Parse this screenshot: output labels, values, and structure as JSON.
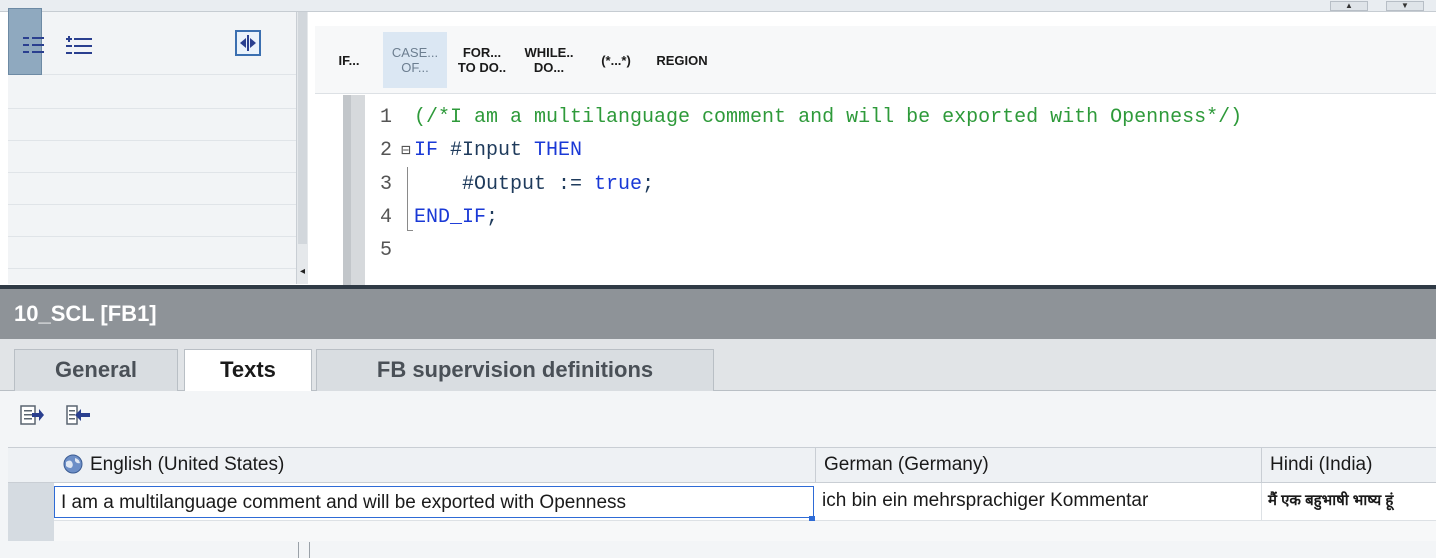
{
  "editor": {
    "toolbar": [
      {
        "label": "IF..."
      },
      {
        "label": "CASE...\nOF..."
      },
      {
        "label": "FOR...\nTO DO.."
      },
      {
        "label": "WHILE..\nDO..."
      },
      {
        "label": "(*...*)"
      },
      {
        "label": "REGION"
      }
    ],
    "code": {
      "line_numbers": [
        "1",
        "2",
        "3",
        "4",
        "5"
      ],
      "line1_comment": "(/*I am a multilanguage comment and will be exported with Openness*/)",
      "line2_if": "IF",
      "line2_var": " #Input ",
      "line2_then": "THEN",
      "line3_indent": "    ",
      "line3_var": "#Output := ",
      "line3_value": "true",
      "line3_end": ";",
      "line4_end_if": "END_IF",
      "line4_semicolon": ";"
    }
  },
  "inspector": {
    "title": "10_SCL [FB1]",
    "tabs": [
      {
        "label": "General",
        "active": false
      },
      {
        "label": "Texts",
        "active": true
      },
      {
        "label": "FB supervision definitions",
        "active": false
      }
    ]
  },
  "texts_table": {
    "columns": [
      {
        "label": "English (United States)"
      },
      {
        "label": "German (Germany)"
      },
      {
        "label": "Hindi (India)"
      }
    ],
    "row": {
      "english": "I am a multilanguage comment and will be exported with Openness",
      "german": "ich bin ein mehrsprachiger Kommentar",
      "hindi": "मैं एक बहुभाषी भाष्य हूं"
    }
  },
  "icons": {
    "left_toolbar": [
      "collapse-all-icon",
      "expand-list-icon",
      "swap-panes-icon"
    ],
    "texts_toolbar": [
      "export-texts-icon",
      "import-texts-icon"
    ],
    "column_header": "globe-icon"
  },
  "colors": {
    "comment": "#2e9a3a",
    "keyword": "#1a39d6",
    "inspector_title_bg": "#8e9398",
    "selection_border": "#2e6bd6"
  }
}
